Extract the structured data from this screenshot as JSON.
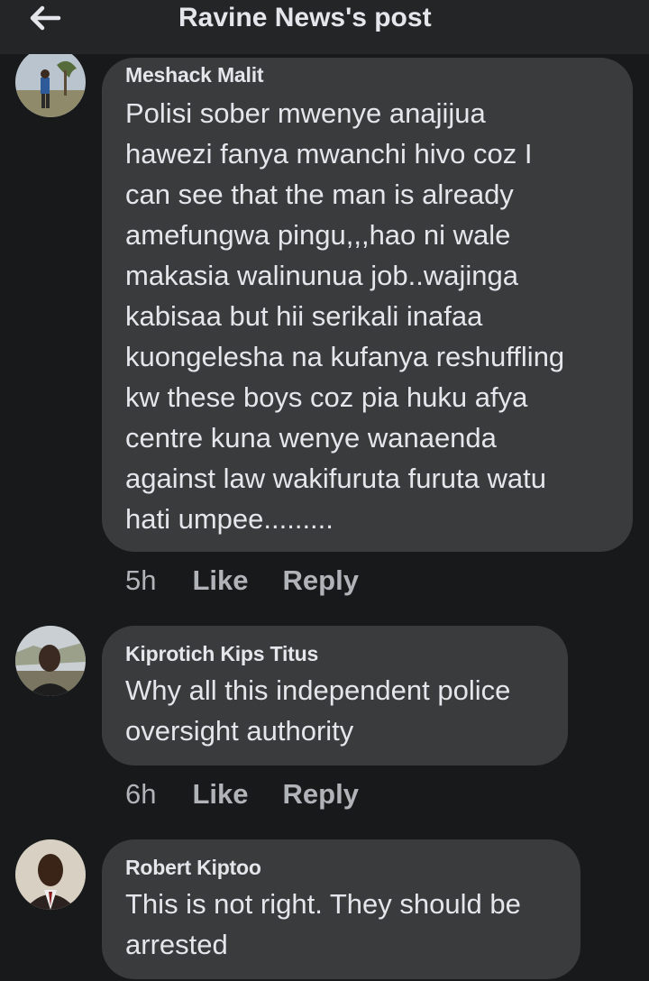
{
  "header": {
    "title": "Ravine News's post",
    "back_icon": "arrow-left-icon"
  },
  "comments": [
    {
      "author": "Meshack Malit",
      "text": "Polisi sober mwenye anajijua\nhawezi fanya mwanchi hivo coz I\ncan see that  the man is already\namefungwa pingu,,,hao ni wale\nmakasia walinunua job..wajinga\nkabisaa but hii serikali inafaa\nkuongelesha na kufanya reshuffling\nkw these boys coz pia huku afya\ncentre kuna wenye wanaenda\nagainst law wakifuruta furuta watu\nhati umpee.........",
      "time": "5h",
      "like_label": "Like",
      "reply_label": "Reply"
    },
    {
      "author": "Kiprotich Kips Titus",
      "text": "Why all this independent police\noversight authority",
      "time": "6h",
      "like_label": "Like",
      "reply_label": "Reply"
    },
    {
      "author": "Robert Kiptoo",
      "text": "This is not right. They should be\narrested"
    }
  ],
  "colors": {
    "background": "#18191a",
    "header": "#242526",
    "bubble": "#3a3b3c",
    "text": "#e4e6eb",
    "muted": "#b0b3b8"
  }
}
